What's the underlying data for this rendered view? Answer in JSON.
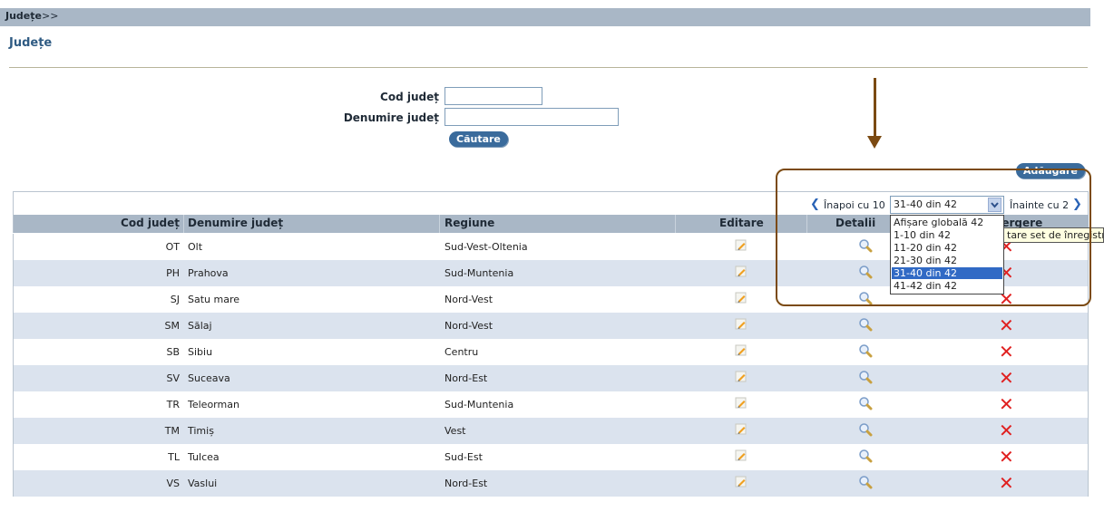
{
  "breadcrumb": {
    "label": "Județe",
    "separator": ">>"
  },
  "page_title": "Județe",
  "search": {
    "code_label": "Cod județ",
    "name_label": "Denumire județ",
    "code_value": "",
    "name_value": "",
    "button_label": "Căutare"
  },
  "add_button_label": "Adăugare",
  "pager": {
    "back_label": "Înapoi cu 10",
    "forward_label": "Înainte cu 2",
    "selected": "31-40 din 42",
    "options": [
      "Afișare globală 42",
      "1-10 din 42",
      "11-20 din 42",
      "21-30 din 42",
      "31-40 din 42",
      "41-42 din 42"
    ],
    "tooltip": "tare set de înregistrări"
  },
  "table": {
    "headers": {
      "code": "Cod județ",
      "name": "Denumire județ",
      "region": "Regiune",
      "edit": "Editare",
      "details": "Detalii",
      "delete": "Ştergere"
    },
    "rows": [
      {
        "code": "OT",
        "name": "Olt",
        "region": "Sud-Vest-Oltenia"
      },
      {
        "code": "PH",
        "name": "Prahova",
        "region": "Sud-Muntenia"
      },
      {
        "code": "SJ",
        "name": "Satu mare",
        "region": "Nord-Vest"
      },
      {
        "code": "SM",
        "name": "Sălaj",
        "region": "Nord-Vest"
      },
      {
        "code": "SB",
        "name": "Sibiu",
        "region": "Centru"
      },
      {
        "code": "SV",
        "name": "Suceava",
        "region": "Nord-Est"
      },
      {
        "code": "TR",
        "name": "Teleorman",
        "region": "Sud-Muntenia"
      },
      {
        "code": "TM",
        "name": "Timiș",
        "region": "Vest"
      },
      {
        "code": "TL",
        "name": "Tulcea",
        "region": "Sud-Est"
      },
      {
        "code": "VS",
        "name": "Vaslui",
        "region": "Nord-Est"
      }
    ]
  },
  "icons": {
    "edit": "pencil-icon",
    "details": "magnifier-icon",
    "delete": "delete-x-icon",
    "back": "chevron-left-icon",
    "forward": "chevron-right-icon"
  },
  "colors": {
    "header_bg": "#a9b7c6",
    "accent": "#2f5b83",
    "annotation": "#7b4a12",
    "delete": "#e02020",
    "row_alt": "#dbe3ee"
  }
}
